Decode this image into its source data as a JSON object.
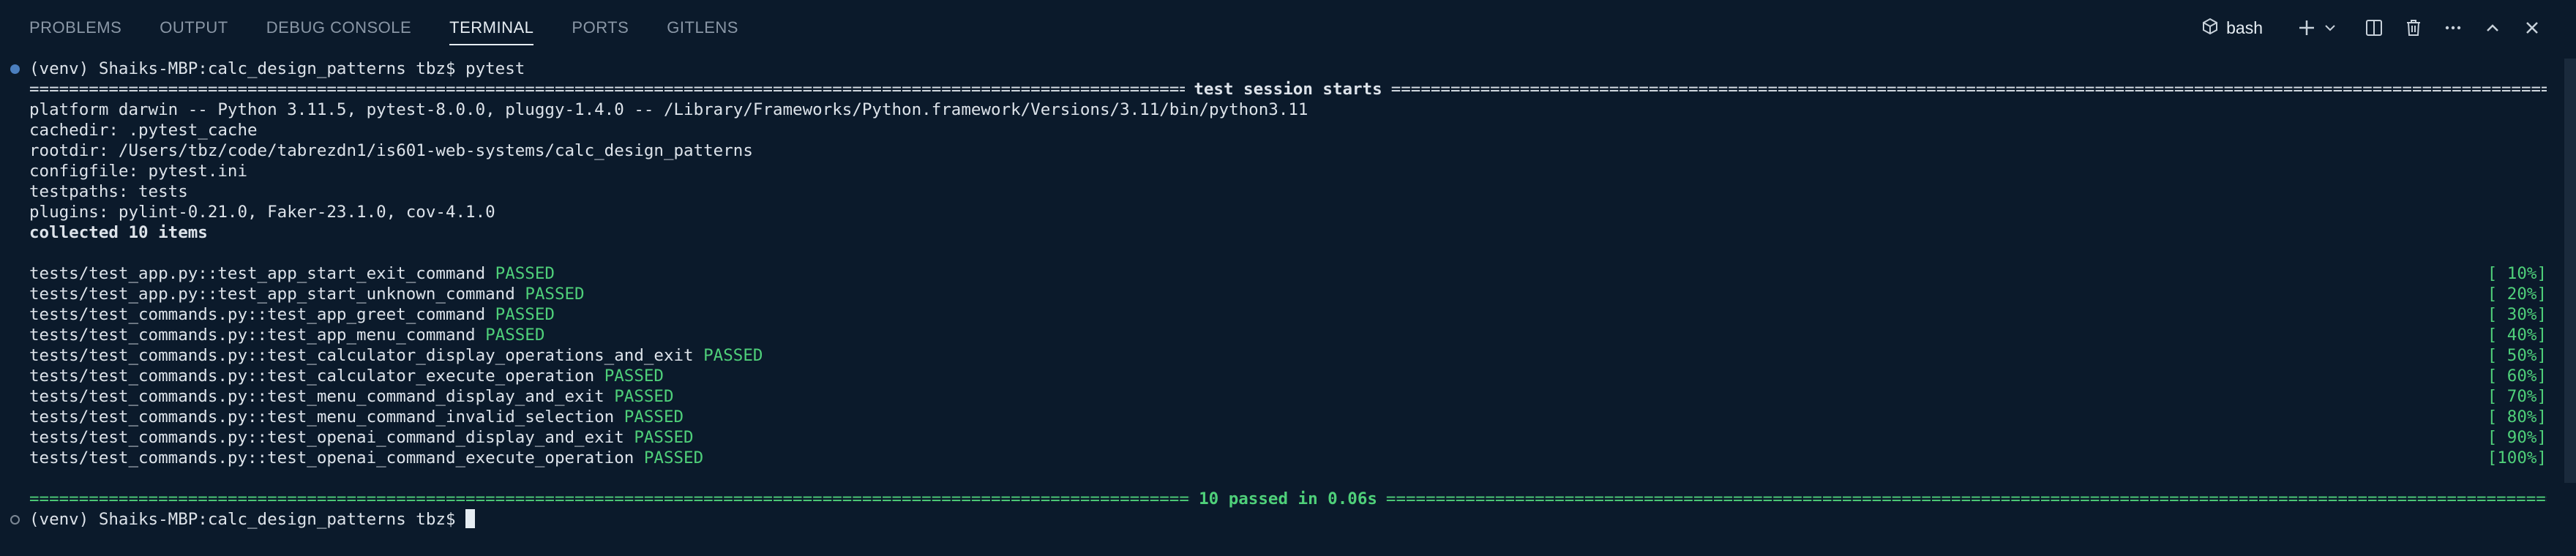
{
  "tabs": [
    {
      "label": "PROBLEMS"
    },
    {
      "label": "OUTPUT"
    },
    {
      "label": "DEBUG CONSOLE"
    },
    {
      "label": "TERMINAL",
      "active": true
    },
    {
      "label": "PORTS"
    },
    {
      "label": "GITLENS"
    }
  ],
  "terminal_selector": {
    "label": "bash",
    "icon": "terminal-shell-icon"
  },
  "actions": [
    {
      "name": "new-terminal-icon"
    },
    {
      "name": "chevron-down-icon"
    },
    {
      "name": "split-terminal-icon"
    },
    {
      "name": "trash-icon"
    },
    {
      "name": "more-actions-icon"
    },
    {
      "name": "maximize-panel-icon"
    },
    {
      "name": "close-panel-icon"
    }
  ],
  "terminal": {
    "prompt1": "(venv) Shaiks-MBP:calc_design_patterns tbz$ pytest",
    "session_title": "test session starts",
    "platform": "platform darwin -- Python 3.11.5, pytest-8.0.0, pluggy-1.4.0 -- /Library/Frameworks/Python.framework/Versions/3.11/bin/python3.11",
    "cachedir": "cachedir: .pytest_cache",
    "rootdir": "rootdir: /Users/tbz/code/tabrezdn1/is601-web-systems/calc_design_patterns",
    "configfile": "configfile: pytest.ini",
    "testpaths": "testpaths: tests",
    "plugins": "plugins: pylint-0.21.0, Faker-23.1.0, cov-4.1.0",
    "collected": "collected 10 items",
    "results": [
      {
        "name": "tests/test_app.py::test_app_start_exit_command",
        "status": "PASSED",
        "pct": "[ 10%]"
      },
      {
        "name": "tests/test_app.py::test_app_start_unknown_command",
        "status": "PASSED",
        "pct": "[ 20%]"
      },
      {
        "name": "tests/test_commands.py::test_app_greet_command",
        "status": "PASSED",
        "pct": "[ 30%]"
      },
      {
        "name": "tests/test_commands.py::test_app_menu_command",
        "status": "PASSED",
        "pct": "[ 40%]"
      },
      {
        "name": "tests/test_commands.py::test_calculator_display_operations_and_exit",
        "status": "PASSED",
        "pct": "[ 50%]"
      },
      {
        "name": "tests/test_commands.py::test_calculator_execute_operation",
        "status": "PASSED",
        "pct": "[ 60%]"
      },
      {
        "name": "tests/test_commands.py::test_menu_command_display_and_exit",
        "status": "PASSED",
        "pct": "[ 70%]"
      },
      {
        "name": "tests/test_commands.py::test_menu_command_invalid_selection",
        "status": "PASSED",
        "pct": "[ 80%]"
      },
      {
        "name": "tests/test_commands.py::test_openai_command_display_and_exit",
        "status": "PASSED",
        "pct": "[ 90%]"
      },
      {
        "name": "tests/test_commands.py::test_openai_command_execute_operation",
        "status": "PASSED",
        "pct": "[100%]"
      }
    ],
    "summary_passed": "10 passed",
    "summary_time": " in 0.06s",
    "prompt2": "(venv) Shaiks-MBP:calc_design_patterns tbz$ "
  },
  "colors": {
    "background": "#0b1a2b",
    "passed": "#4fd07a",
    "text": "#dde3ea"
  }
}
